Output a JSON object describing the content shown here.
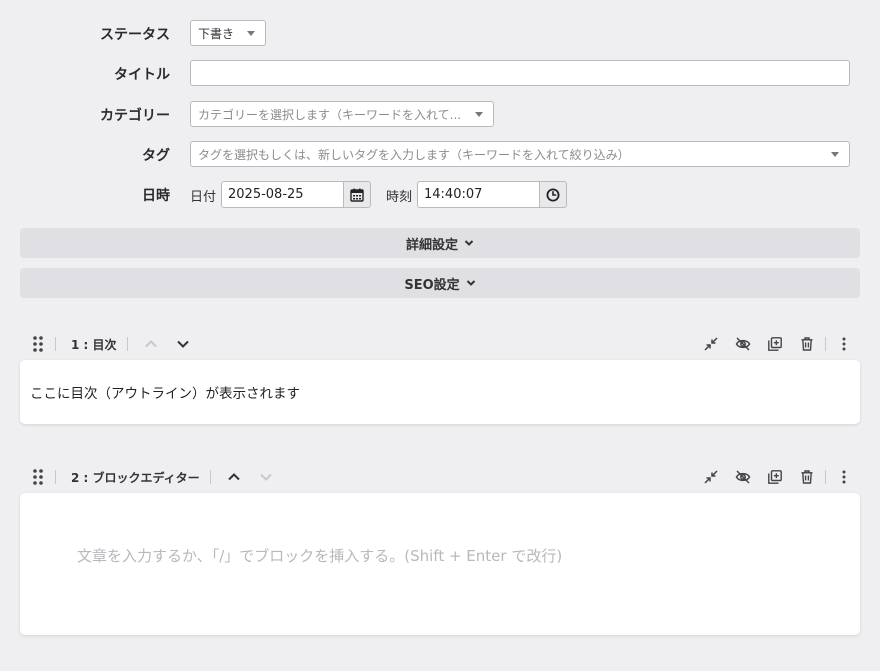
{
  "form": {
    "status": {
      "label": "ステータス",
      "value": "下書き"
    },
    "title": {
      "label": "タイトル",
      "value": ""
    },
    "category": {
      "label": "カテゴリー",
      "placeholder": "カテゴリーを選択します（キーワードを入れて..."
    },
    "tags": {
      "label": "タグ",
      "placeholder": "タグを選択もしくは、新しいタグを入力します（キーワードを入れて絞り込み）"
    },
    "datetime": {
      "label": "日時",
      "date_label": "日付",
      "date_value": "2025-08-25",
      "time_label": "時刻",
      "time_value": "14:40:07"
    }
  },
  "accordions": {
    "advanced": "詳細設定",
    "seo": "SEO設定"
  },
  "blocks": [
    {
      "title": "1 : 目次",
      "content": "ここに目次（アウトライン）が表示されます"
    },
    {
      "title": "2 : ブロックエディター",
      "placeholder": "文章を入力するか、「/」でブロックを挿入する。(Shift + Enter で改行)"
    }
  ],
  "colors": {
    "background": "#efeff2",
    "accordion": "#dfdfe4",
    "border": "#b9b9bf",
    "icon": "#4a4a4f"
  }
}
